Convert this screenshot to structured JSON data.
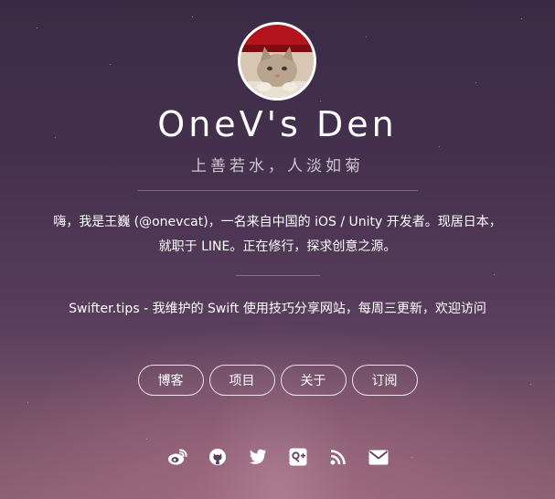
{
  "site": {
    "title": "OneV's Den",
    "motto": "上善若水，人淡如菊"
  },
  "bio": {
    "line1": "嗨，我是王巍 (@onevcat)，一名来自中国的 iOS / Unity 开发者。现居日本，",
    "line2": "就职于 LINE。正在修行，探求创意之源。"
  },
  "promo": {
    "link_text": "Swifter.tips",
    "text": " - 我维护的 Swift 使用技巧分享网站，每周三更新，欢迎访问"
  },
  "nav": {
    "items": [
      {
        "label": "博客"
      },
      {
        "label": "项目"
      },
      {
        "label": "关于"
      },
      {
        "label": "订阅"
      }
    ]
  },
  "social": {
    "icons": [
      "weibo-icon",
      "github-icon",
      "twitter-icon",
      "google-plus-icon",
      "rss-icon",
      "email-icon"
    ]
  },
  "colors": {
    "text": "#ffffff",
    "background_top": "#3a2b45",
    "background_bottom": "#8d6272"
  }
}
